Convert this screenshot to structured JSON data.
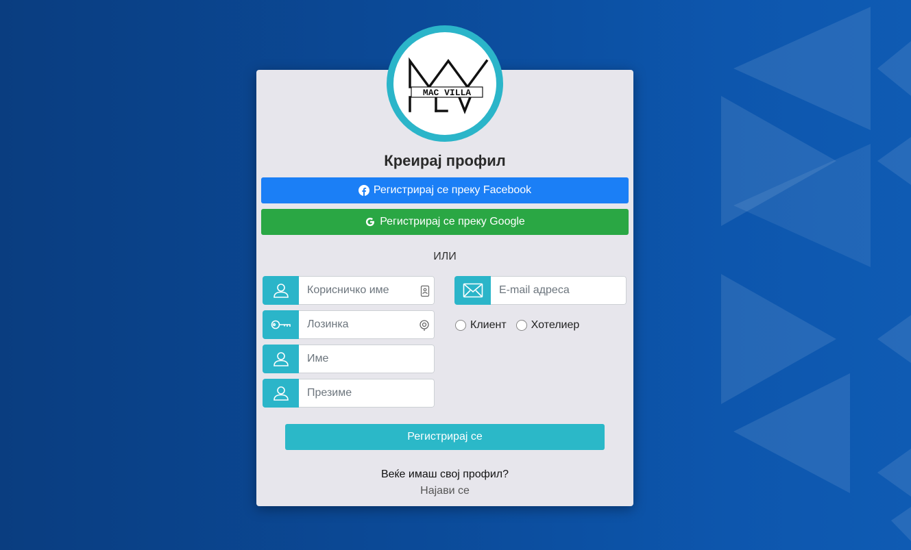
{
  "logo": {
    "line1": "MAC VILLA"
  },
  "title": "Креирај профил",
  "social": {
    "facebook_label": "Регистрирај се преку Facebook",
    "google_label": "Регистрирај се преку Google"
  },
  "divider": "ИЛИ",
  "form": {
    "username_placeholder": "Корисничко име",
    "password_placeholder": "Лозинка",
    "firstname_placeholder": "Име",
    "lastname_placeholder": "Презиме",
    "email_placeholder": "E-mail адреса",
    "role_options": [
      "Клиент",
      "Хотелиер"
    ],
    "submit_label": "Регистрирај се"
  },
  "footer": {
    "already_text": "Веќе имаш свој профил?",
    "login_link": "Најави се"
  },
  "colors": {
    "accent": "#2bb5c9",
    "facebook": "#1b7ff6",
    "google": "#2aa744",
    "card": "#e7e6ec"
  }
}
